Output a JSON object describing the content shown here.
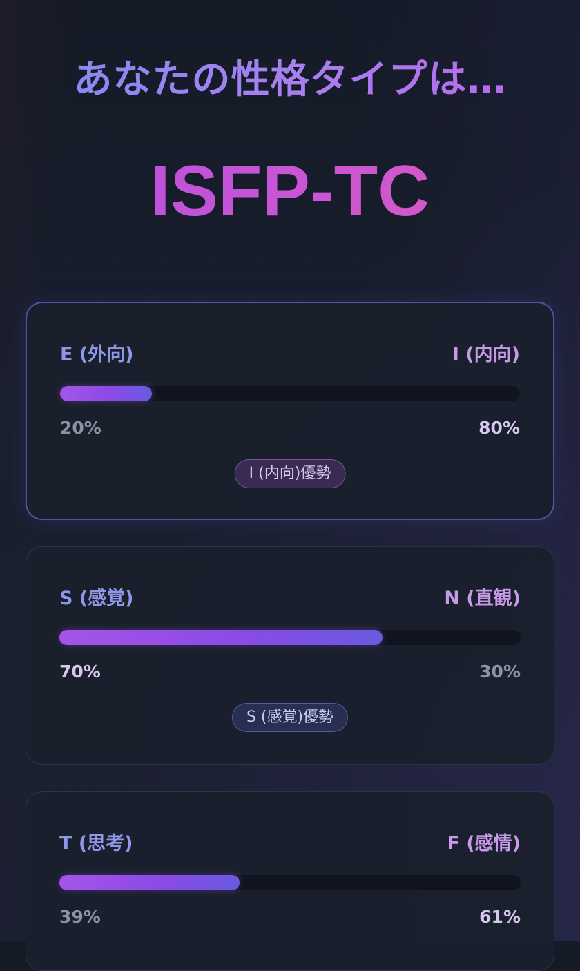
{
  "header": {
    "title": "あなたの性格タイプは…",
    "type_code": "ISFP-TC"
  },
  "dimensions": [
    {
      "left_label": "E (外向)",
      "right_label": "I (内向)",
      "left_percent": "20%",
      "right_percent": "80%",
      "fill_fraction": 0.2,
      "dominant_badge": "I (内向)優勢",
      "badge_color": "purple"
    },
    {
      "left_label": "S (感覚)",
      "right_label": "N (直観)",
      "left_percent": "70%",
      "right_percent": "30%",
      "fill_fraction": 0.7,
      "dominant_badge": "S (感覚)優勢",
      "badge_color": "blue"
    },
    {
      "left_label": "T (思考)",
      "right_label": "F (感情)",
      "left_percent": "39%",
      "right_percent": "61%",
      "fill_fraction": 0.39
    }
  ],
  "colors": {
    "accent_purple": "#a455e8",
    "accent_blue": "#6a5ae0",
    "type_code_gradient_start": "#b34fdc",
    "type_code_gradient_end": "#dc5cb6"
  }
}
